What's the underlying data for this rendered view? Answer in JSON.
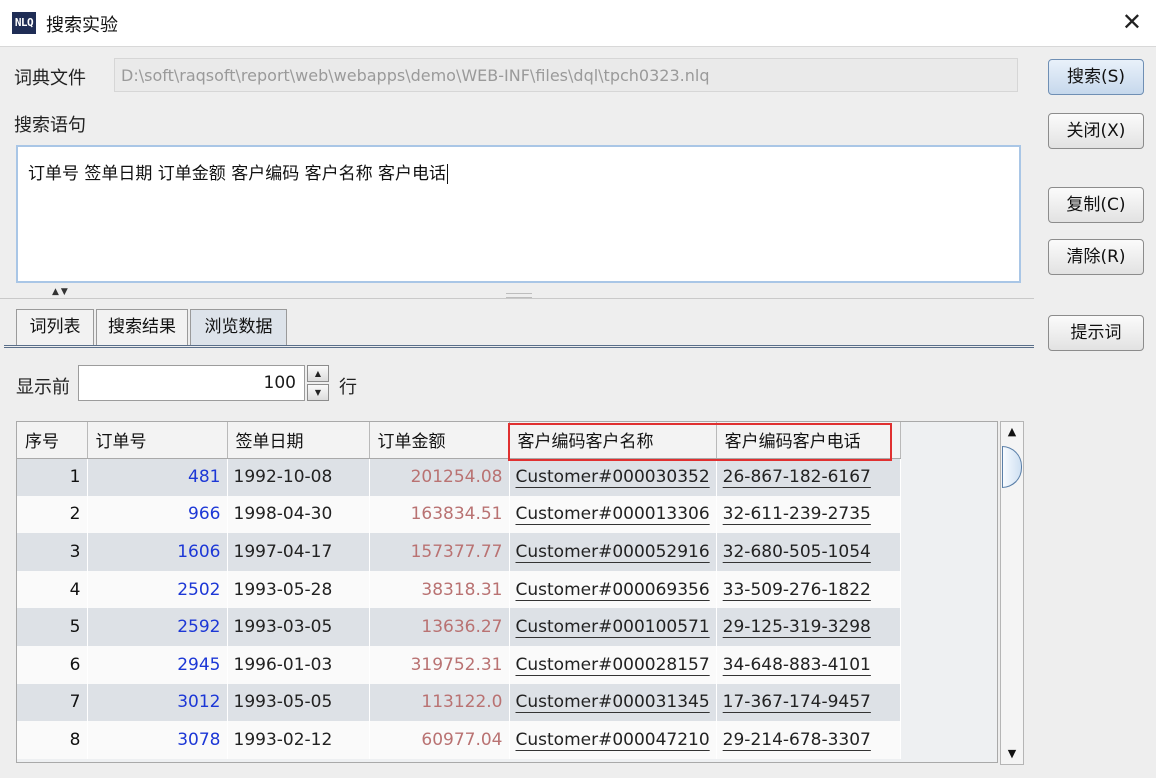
{
  "window": {
    "icon_text": "NLQ",
    "title": "搜索实验",
    "close_glyph": "✕"
  },
  "dict": {
    "label": "词典文件",
    "path": "D:\\soft\\raqsoft\\report\\web\\webapps\\demo\\WEB-INF\\files\\dql\\tpch0323.nlq"
  },
  "query": {
    "label": "搜索语句",
    "text": "订单号 签单日期 订单金额 客户编码 客户名称 客户电话"
  },
  "buttons": {
    "search": "搜索(S)",
    "close": "关闭(X)",
    "copy": "复制(C)",
    "clear": "清除(R)",
    "hint": "提示词"
  },
  "tabs": [
    {
      "label": "词列表",
      "active": false
    },
    {
      "label": "搜索结果",
      "active": false
    },
    {
      "label": "浏览数据",
      "active": true
    }
  ],
  "display": {
    "prefix": "显示前",
    "count": "100",
    "suffix": "行"
  },
  "grid": {
    "headers": [
      "序号",
      "订单号",
      "签单日期",
      "订单金额",
      "客户编码客户名称",
      "客户编码客户电话"
    ],
    "rows": [
      [
        "1",
        "481",
        "1992-10-08",
        "201254.08",
        "Customer#000030352",
        "26-867-182-6167"
      ],
      [
        "2",
        "966",
        "1998-04-30",
        "163834.51",
        "Customer#000013306",
        "32-611-239-2735"
      ],
      [
        "3",
        "1606",
        "1997-04-17",
        "157377.77",
        "Customer#000052916",
        "32-680-505-1054"
      ],
      [
        "4",
        "2502",
        "1993-05-28",
        "38318.31",
        "Customer#000069356",
        "33-509-276-1822"
      ],
      [
        "5",
        "2592",
        "1993-03-05",
        "13636.27",
        "Customer#000100571",
        "29-125-319-3298"
      ],
      [
        "6",
        "2945",
        "1996-01-03",
        "319752.31",
        "Customer#000028157",
        "34-648-883-4101"
      ],
      [
        "7",
        "3012",
        "1993-05-05",
        "113122.0",
        "Customer#000031345",
        "17-367-174-9457"
      ],
      [
        "8",
        "3078",
        "1993-02-12",
        "60977.04",
        "Customer#000047210",
        "29-214-678-3307"
      ]
    ]
  },
  "colors": {
    "order_no": "#1c37d6",
    "amount": "#b97272",
    "highlight": "#e03030"
  },
  "icons": {
    "spin_up": "▲",
    "spin_down": "▼",
    "scroll_up": "▲",
    "scroll_down": "▼",
    "splitter": "▲▼"
  }
}
